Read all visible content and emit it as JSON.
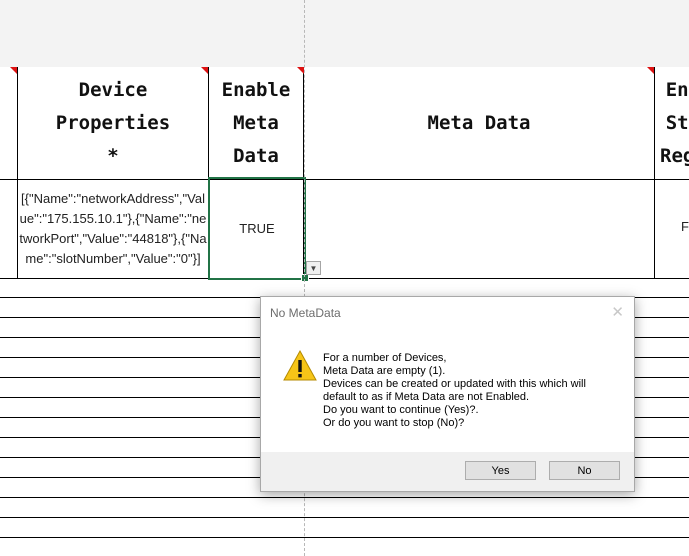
{
  "columns": {
    "device_properties": "Device Properties\n*",
    "enable_meta_data": "Enable\nMeta\nData",
    "meta_data": "Meta Data",
    "next_clipped": "En\nSt\nReg"
  },
  "row1": {
    "device_properties": "[{\"Name\":\"networkAddress\",\"Value\":\"175.155.10.1\"},{\"Name\":\"networkPort\",\"Value\":\"44818\"},{\"Name\":\"slotNumber\",\"Value\":\"0\"}]",
    "enable_meta_data": "TRUE",
    "next_clipped": "F"
  },
  "dropdown_glyph": "▼",
  "dialog": {
    "title": "No MetaData",
    "close_glyph": "✕",
    "icon": "warning-icon",
    "lines": [
      "For a number of Devices,",
      "Meta Data are empty (1).",
      "Devices can be created or updated with this which will",
      "default to as if Meta Data are not Enabled.",
      "Do you want to continue (Yes)?.",
      "Or do you want to stop (No)?"
    ],
    "yes_label": "Yes",
    "no_label": "No",
    "warning_color": "#f6c518"
  }
}
